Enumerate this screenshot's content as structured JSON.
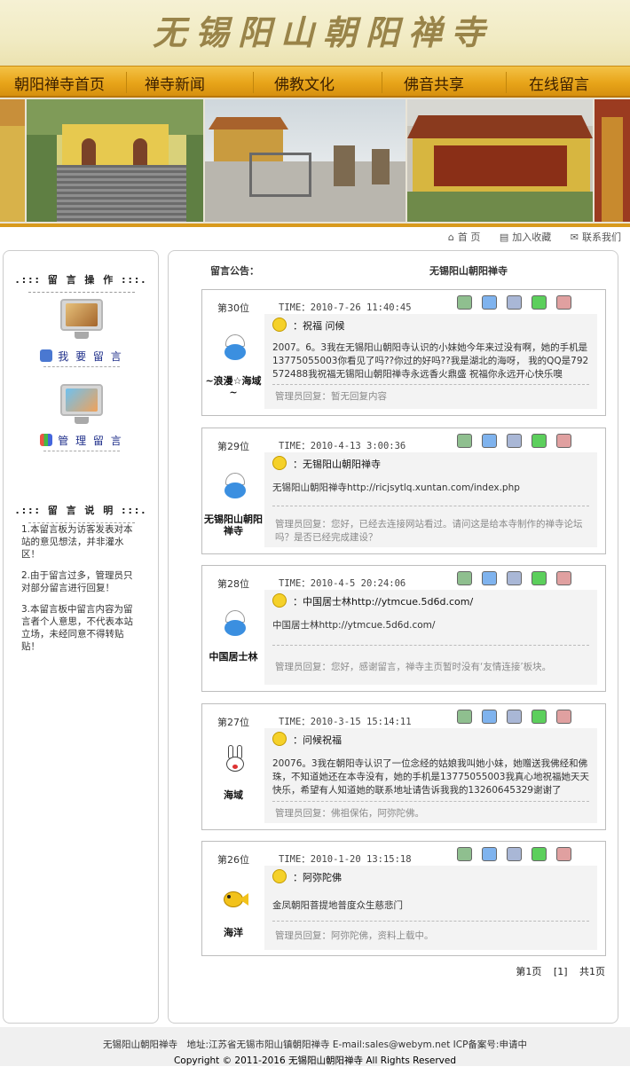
{
  "site": {
    "title": "无锡阳山朝阳禅寺"
  },
  "nav": {
    "items": [
      "朝阳禅寺首页",
      "禅寺新闻",
      "佛教文化",
      "佛音共享",
      "在线留言"
    ]
  },
  "toplinks": {
    "home": "首 页",
    "favorite": "加入收藏",
    "contact": "联系我们"
  },
  "sidebar": {
    "ops_title": ".::: 留 言 操 作 :::.",
    "my_message": "我 要 留 言",
    "manage_message": "管 理 留 言",
    "notes_title": ".::: 留 言 说 明 :::.",
    "notes": [
      "1.本留言板为访客发表对本站的意见想法，并非灌水区！",
      "2.由于留言过多，管理员只对部分留言进行回复！",
      "3.本留言板中留言内容为留言者个人意思，不代表本站立场，未经同意不得转贴贴！"
    ]
  },
  "notice": {
    "label": "留言公告：",
    "text": "无锡阳山朝阳禅寺"
  },
  "entries": [
    {
      "rank": "第30位",
      "user": "~浪漫☆海域~",
      "time": "TIME：2010-7-26 11:40:45",
      "subject": "：祝福 问候",
      "body": "2007。6。3我在无锡阳山朝阳寺认识的小妹她今年来过没有啊，她的手机是13775055003你看见了吗??你过的好吗??我是湖北的海呀， 我的QQ是792572488我祝福无锡阳山朝阳禅寺永远香火鼎盛 祝福你永远开心快乐噢",
      "reply": "管理员回复：暂无回复内容"
    },
    {
      "rank": "第29位",
      "user": "无锡阳山朝阳禅寺",
      "time": "TIME：2010-4-13 3:00:36",
      "subject": "：无锡阳山朝阳禅寺",
      "body": "无锡阳山朝阳禅寺http://ricjsytlq.xuntan.com/index.php",
      "reply": "管理员回复：您好，已经去连接网站看过。请问这是给本寺制作的禅寺论坛吗？是否已经完成建设？"
    },
    {
      "rank": "第28位",
      "user": "中国居士林",
      "time": "TIME：2010-4-5 20:24:06",
      "subject": "：中国居士林http://ytmcue.5d6d.com/",
      "body": "中国居士林http://ytmcue.5d6d.com/",
      "reply": "管理员回复：您好，感谢留言，禅寺主页暂时没有‘友情连接’板块。"
    },
    {
      "rank": "第27位",
      "user": "海域",
      "time": "TIME：2010-3-15 15:14:11",
      "subject": "：问候祝福",
      "body": "20076。3我在朝阳寺认识了一位念经的姑娘我叫她小妹，她赠送我佛经和佛珠，不知道她还在本寺没有，她的手机是13775055003我真心地祝福她天天快乐，希望有人知道她的联系地址请告诉我我的13260645329谢谢了",
      "reply": "管理员回复：佛祖保佑，阿弥陀佛。"
    },
    {
      "rank": "第26位",
      "user": "海洋",
      "time": "TIME：2010-1-20 13:15:18",
      "subject": "：阿弥陀佛",
      "body": "金凤朝阳菩提地普度众生慈悲门",
      "reply": "管理员回复：阿弥陀佛，资料上载中。"
    }
  ],
  "pager": {
    "current": "第1页",
    "page": "[1]",
    "total": "共1页"
  },
  "footer": {
    "line1": "无锡阳山朝阳禅寺　地址:江苏省无锡市阳山镇朝阳禅寺 E-mail:sales@webym.net ICP备案号:申请中",
    "line2": "Copyright © 2011-2016 无锡阳山朝阳禅寺 All Rights Reserved"
  },
  "colors": {
    "nav": "#e8a51a",
    "banner": "#f1ebc3",
    "link": "#1f2f8a"
  },
  "icons": [
    "edit-icon",
    "copy-icon",
    "mail-icon",
    "reply-icon",
    "delete-icon"
  ]
}
